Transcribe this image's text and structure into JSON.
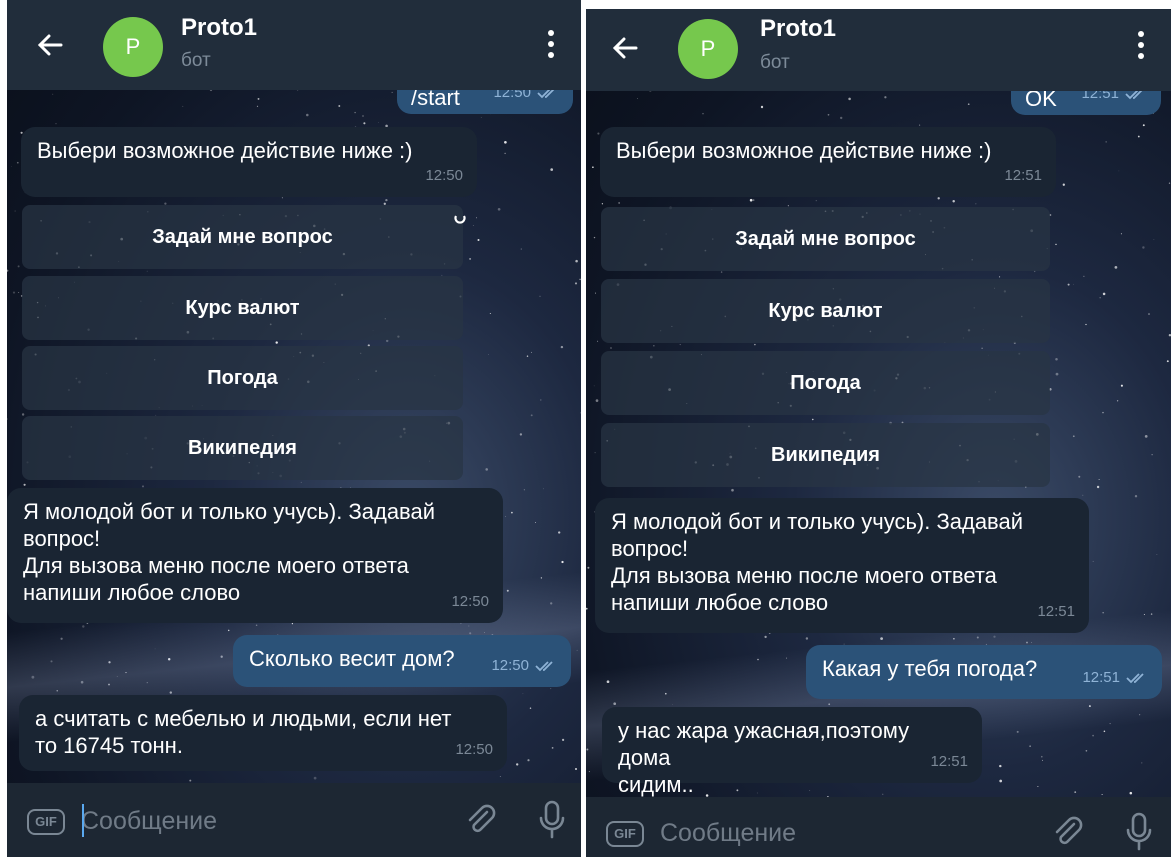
{
  "left": {
    "header": {
      "title": "Proto1",
      "subtitle": "бот",
      "avatar_letter": "P"
    },
    "messages": {
      "start_time": "12:50",
      "start_text": "/start",
      "menu_prompt": {
        "text": "Выбери возможное действие ниже :)",
        "time": "12:50"
      },
      "reply": {
        "lines": [
          "Я молодой бот и только учусь). Задавай",
          "вопрос!",
          "Для вызова меню после моего ответа",
          "напиши любое слово"
        ],
        "time": "12:50"
      },
      "question": {
        "text": "Сколько весит дом?",
        "time": "12:50"
      },
      "answer": {
        "lines": [
          "а считать с мебелью и людьми, если нет",
          "то 16745 тонн."
        ],
        "time": "12:50"
      }
    },
    "keyboard": [
      "Задай мне вопрос",
      "Курс валют",
      "Погода",
      "Википедия"
    ],
    "input": {
      "placeholder": "Сообщение",
      "gif_label": "GIF"
    }
  },
  "right": {
    "header": {
      "title": "Proto1",
      "subtitle": "бот",
      "avatar_letter": "P"
    },
    "messages": {
      "start_time": "12:51",
      "start_text": "OK",
      "menu_prompt": {
        "text": "Выбери возможное действие ниже :)",
        "time": "12:51"
      },
      "reply": {
        "lines": [
          "Я молодой бот и только учусь). Задавай",
          "вопрос!",
          "Для вызова меню после моего ответа",
          "напиши любое слово"
        ],
        "time": "12:51"
      },
      "question": {
        "text": "Какая у тебя погода?",
        "time": "12:51"
      },
      "answer": {
        "lines": [
          "у нас жара ужасная,поэтому дома",
          "сидим.."
        ],
        "time": "12:51"
      }
    },
    "keyboard": [
      "Задай мне вопрос",
      "Курс валют",
      "Погода",
      "Википедия"
    ],
    "input": {
      "placeholder": "Сообщение",
      "gif_label": "GIF"
    }
  },
  "colors": {
    "header": "#212d3b",
    "bubble_in": "#1a2533",
    "bubble_out": "#2b5278",
    "avatar": "#76c84d",
    "caret": "#5aa9f0"
  }
}
